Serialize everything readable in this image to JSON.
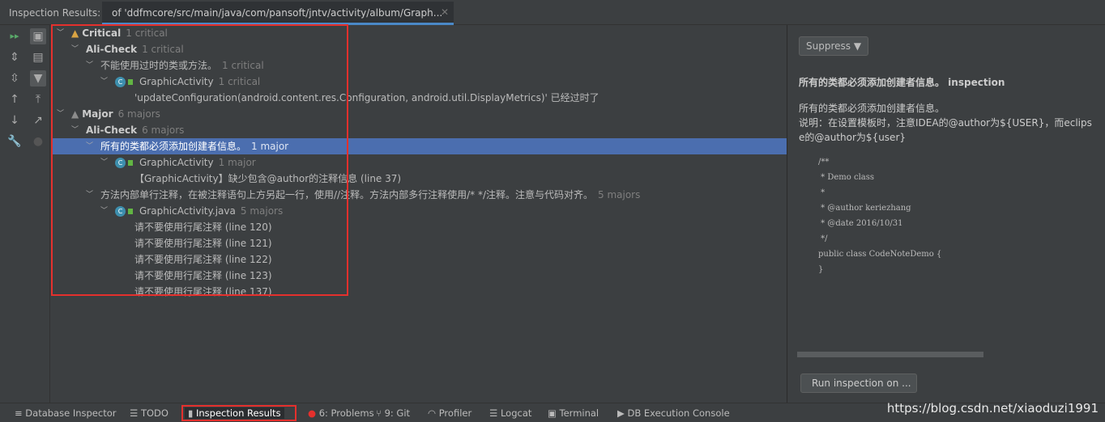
{
  "header": {
    "title": "Inspection Results:",
    "tab": "of 'ddfmcore/src/main/java/com/pansoft/jntv/activity/album/Graph...",
    "close_icon": "close-icon"
  },
  "toolbar": [
    "rerun-icon",
    "group-icon",
    "expand-all-icon",
    "module-icon",
    "collapse-all-icon",
    "filter-icon",
    "prev-icon",
    "export-up-icon",
    "next-icon",
    "open-external-icon",
    "settings-wrench-icon",
    "bulb-icon"
  ],
  "tree": [
    {
      "level": 0,
      "label": "Critical",
      "count": "1 critical",
      "bold": true,
      "icon": "warning-icon"
    },
    {
      "level": 1,
      "label": "Ali-Check",
      "count": "1 critical",
      "bold": true
    },
    {
      "level": 2,
      "label": "不能使用过时的类或方法。",
      "count": "1 critical"
    },
    {
      "level": 3,
      "label": "GraphicActivity",
      "count": "1 critical",
      "icon": "class-icon"
    },
    {
      "level": 4,
      "label": "'updateConfiguration(android.content.res.Configuration, android.util.DisplayMetrics)' 已经过时了",
      "count": ""
    },
    {
      "level": 0,
      "label": "Major",
      "count": "6 majors",
      "bold": true,
      "icon": "warning-icon"
    },
    {
      "level": 1,
      "label": "Ali-Check",
      "count": "6 majors",
      "bold": true
    },
    {
      "level": 2,
      "label": "所有的类都必须添加创建者信息。",
      "count": "1 major",
      "selected": true
    },
    {
      "level": 3,
      "label": "GraphicActivity",
      "count": "1 major",
      "icon": "class-icon"
    },
    {
      "level": 4,
      "label": "【GraphicActivity】缺少包含@author的注释信息 (line 37)",
      "count": ""
    },
    {
      "level": 2,
      "label": "方法内部单行注释，在被注释语句上方另起一行，使用//注释。方法内部多行注释使用/* */注释。注意与代码对齐。",
      "count": "5 majors"
    },
    {
      "level": 3,
      "label": "GraphicActivity.java",
      "count": "5 majors",
      "icon": "class-icon"
    },
    {
      "level": 4,
      "label": "请不要使用行尾注释 (line 120)",
      "count": ""
    },
    {
      "level": 4,
      "label": "请不要使用行尾注释 (line 121)",
      "count": ""
    },
    {
      "level": 4,
      "label": "请不要使用行尾注释 (line 122)",
      "count": ""
    },
    {
      "level": 4,
      "label": "请不要使用行尾注释 (line 123)",
      "count": ""
    },
    {
      "level": 4,
      "label": "请不要使用行尾注释 (line 137)",
      "count": ""
    }
  ],
  "details": {
    "suppress": "Suppress ▼",
    "title": "所有的类都必须添加创建者信息。 inspection",
    "desc1": "所有的类都必须添加创建者信息。",
    "desc2": "说明：在设置模板时，注意IDEA的@author为${USER}，而eclipse的@author为${user}",
    "code": "/**\n * Demo class\n *\n * @author keriezhang\n * @date 2016/10/31\n */\npublic class CodeNoteDemo {\n}",
    "run": "Run inspection on ..."
  },
  "bottom": [
    {
      "label": "Database Inspector",
      "icon": "≡"
    },
    {
      "label": "TODO",
      "icon": "☰"
    },
    {
      "label": "Inspection Results",
      "icon": "▮",
      "active": true
    },
    {
      "label": "6: Problems",
      "icon": "●"
    },
    {
      "label": "9: Git",
      "icon": "⑂"
    },
    {
      "label": "Profiler",
      "icon": "◠"
    },
    {
      "label": "Logcat",
      "icon": "☰"
    },
    {
      "label": "Terminal",
      "icon": "▣"
    },
    {
      "label": "DB Execution Console",
      "icon": "▶"
    }
  ],
  "watermark": "https://blog.csdn.net/xiaoduzi1991",
  "colors": {
    "accent": "#4b6eaf",
    "highlight_box": "#e5302d",
    "critical": "#d9a343"
  }
}
